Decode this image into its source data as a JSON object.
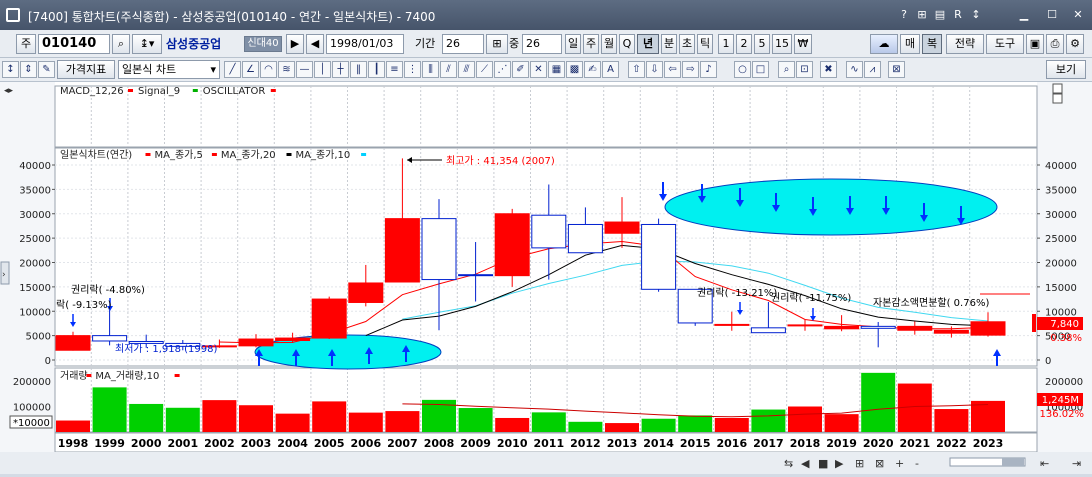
{
  "window": {
    "title": "[7400] 통합차트(주식종합) - 삼성중공업(010140 - 연간 - 일본식차트) - 7400"
  },
  "toolbar1": {
    "market": "주",
    "code": "010140",
    "stock_name": "삼성중공업",
    "credit_badge": "신대40",
    "date": "1998/01/03",
    "period_label": "기간",
    "period_value": "26",
    "count_label": "중",
    "count_value": "26",
    "periods": [
      "일",
      "주",
      "월",
      "Q",
      "년",
      "분",
      "초",
      "틱"
    ],
    "selected_period": "년",
    "intervals": [
      "1",
      "2",
      "5",
      "15",
      "₩"
    ],
    "right_buttons": [
      "매",
      "복",
      "전략",
      "도구"
    ]
  },
  "toolbar2": {
    "indicator_dropdown": "가격지표",
    "chart_type_dropdown": "일본식 차트",
    "view_button": "보기"
  },
  "indicator_panel": {
    "legend": [
      {
        "text": "MACD_12,26",
        "color": "#ff0000"
      },
      {
        "text": "Signal_9",
        "color": "#00b000"
      },
      {
        "text": "OSCILLATOR",
        "color": "#ff0000"
      }
    ]
  },
  "price_panel": {
    "legend_title": "일본식차트(연간)",
    "legend": [
      {
        "text": "MA_종가,5",
        "color": "#ff0000"
      },
      {
        "text": "MA_종가,20",
        "color": "#000000"
      },
      {
        "text": "MA_종가,10",
        "color": "#00d0ff"
      }
    ],
    "y_ticks": [
      "40000",
      "35000",
      "30000",
      "25000",
      "20000",
      "15000",
      "10000",
      "5000",
      "0"
    ],
    "current_price": "7,840",
    "change_pct": "0.38%",
    "annotations": {
      "high": "최고가 : 41,354 (2007)",
      "low": "최저가 : 1,918 (1998)",
      "right1": "권리락( -4.80%)",
      "right2": "락( -9.13%)",
      "right3": "권리락( -13.21%)",
      "right4": "권리락( -11.75%)",
      "capital_reduction": "자본감소액면분할( 0.76%)"
    }
  },
  "volume_panel": {
    "legend": [
      {
        "text": "거래량",
        "color": "#ff0000"
      },
      {
        "text": "MA_거래량,10",
        "color": "#ff0000"
      }
    ],
    "y_ticks": [
      "200000",
      "100000"
    ],
    "unit": "*10000",
    "current_volume": "1,245M",
    "volume_pct": "136.02%"
  },
  "chart_data": {
    "type": "candlestick",
    "title": "일본식차트(연간)",
    "categories": [
      "1998",
      "1999",
      "2000",
      "2001",
      "2002",
      "2003",
      "2004",
      "2005",
      "2006",
      "2007",
      "2008",
      "2009",
      "2010",
      "2011",
      "2012",
      "2013",
      "2014",
      "2015",
      "2016",
      "2017",
      "2018",
      "2019",
      "2020",
      "2021",
      "2022",
      "2023"
    ],
    "open": [
      2000,
      5000,
      3800,
      3400,
      2800,
      2900,
      4000,
      4500,
      11800,
      16000,
      29000,
      17500,
      17300,
      29700,
      27800,
      26000,
      27800,
      14500,
      7200,
      6600,
      7200,
      6400,
      6900,
      6100,
      5500,
      5100
    ],
    "high": [
      5800,
      10900,
      5200,
      4100,
      4200,
      5300,
      5600,
      13000,
      19500,
      41354,
      33000,
      24200,
      31000,
      36000,
      31300,
      33400,
      29000,
      14500,
      9900,
      11900,
      8200,
      9200,
      7800,
      7900,
      6900,
      9800
    ],
    "low": [
      1918,
      3000,
      2500,
      2000,
      2500,
      2600,
      3500,
      4300,
      11000,
      16000,
      6100,
      12000,
      15000,
      16500,
      22000,
      23000,
      14000,
      7000,
      6000,
      6000,
      6000,
      5900,
      2600,
      5200,
      4600,
      4800
    ],
    "close": [
      5000,
      3900,
      3400,
      2800,
      2900,
      4300,
      4500,
      12500,
      15800,
      29000,
      16500,
      17300,
      30000,
      23000,
      22000,
      28300,
      14500,
      7600,
      7300,
      5600,
      7200,
      6900,
      6500,
      6900,
      6100,
      7840
    ],
    "volume": [
      45000,
      175000,
      110000,
      95000,
      125000,
      105000,
      72000,
      120000,
      76000,
      82000,
      126000,
      94000,
      55000,
      77000,
      40000,
      35000,
      52000,
      65000,
      55000,
      88000,
      100000,
      70000,
      232000,
      190000,
      90000,
      122000
    ],
    "ma5": [
      null,
      null,
      null,
      null,
      3700,
      3500,
      3600,
      5400,
      7900,
      13400,
      15600,
      17600,
      20900,
      22800,
      23800,
      24300,
      23300,
      17100,
      14400,
      12200,
      8300,
      7300,
      6800,
      6400,
      6400,
      6700
    ],
    "ma10": [
      null,
      null,
      null,
      null,
      null,
      null,
      null,
      null,
      null,
      8400,
      9800,
      11100,
      13700,
      15700,
      17400,
      19400,
      20300,
      20100,
      19300,
      17800,
      15300,
      12700,
      10800,
      9800,
      8700,
      8000
    ],
    "ma20": [
      null,
      null,
      null,
      null,
      null,
      null,
      null,
      null,
      5000,
      8200,
      9000,
      11000,
      14000,
      17500,
      21500,
      23500,
      22800,
      19800,
      17500,
      15500,
      13200,
      10500,
      8800,
      8000,
      7300,
      7000
    ],
    "ylim": [
      0,
      43000
    ],
    "volume_ylim": [
      0,
      240000
    ]
  }
}
